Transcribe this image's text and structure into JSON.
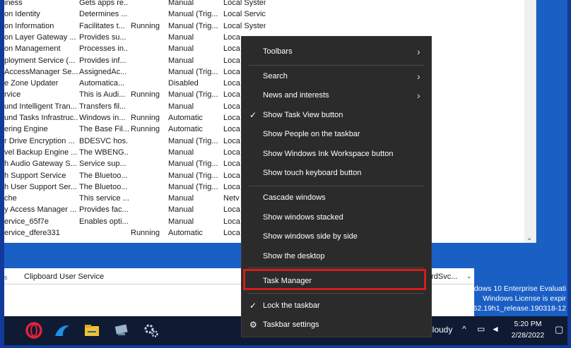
{
  "services": {
    "rows": [
      [
        "iness",
        "Gets apps re...",
        "",
        "Manual",
        "Local System"
      ],
      [
        "on Identity",
        "Determines ...",
        "",
        "Manual (Trig...",
        "Local Service"
      ],
      [
        "on Information",
        "Facilitates t...",
        "Running",
        "Manual (Trig...",
        "Local System"
      ],
      [
        "on Layer Gateway ...",
        "Provides su...",
        "",
        "Manual",
        "Loca"
      ],
      [
        "on Management",
        "Processes in...",
        "",
        "Manual",
        "Loca"
      ],
      [
        "ployment Service (...",
        "Provides inf...",
        "",
        "Manual",
        "Loca"
      ],
      [
        "AccessManager Se...",
        "AssignedAc...",
        "",
        "Manual (Trig...",
        "Loca"
      ],
      [
        "e Zone Updater",
        "Automatica...",
        "",
        "Disabled",
        "Loca"
      ],
      [
        "rvice",
        "This is Audi...",
        "Running",
        "Manual (Trig...",
        "Loca"
      ],
      [
        "und Intelligent Tran...",
        "Transfers fil...",
        "",
        "Manual",
        "Loca"
      ],
      [
        "und Tasks Infrastruc...",
        "Windows in...",
        "Running",
        "Automatic",
        "Loca"
      ],
      [
        "ering Engine",
        "The Base Fil...",
        "Running",
        "Automatic",
        "Loca"
      ],
      [
        "r Drive Encryption ...",
        "BDESVC hos...",
        "",
        "Manual (Trig...",
        "Loca"
      ],
      [
        "vel Backup Engine ...",
        "The WBENG...",
        "",
        "Manual",
        "Loca"
      ],
      [
        "h Audio Gateway S...",
        "Service sup...",
        "",
        "Manual (Trig...",
        "Loca"
      ],
      [
        "h Support Service",
        "The Bluetoo...",
        "",
        "Manual (Trig...",
        "Loca"
      ],
      [
        "h User Support Ser...",
        "The Bluetoo...",
        "",
        "Manual (Trig...",
        "Loca"
      ],
      [
        "che",
        "This service ...",
        "",
        "Manual",
        "Netv"
      ],
      [
        "y Access Manager ...",
        "Provides fac...",
        "",
        "Manual",
        "Loca"
      ],
      [
        "ervice_65f7e",
        "Enables opti...",
        "",
        "Manual",
        "Loca"
      ],
      [
        "ervice_dfere331",
        "",
        "Running",
        "Automatic",
        "Loca"
      ]
    ]
  },
  "lower_panel": {
    "header_label": "Clipboard User Service",
    "header_right": "ardSvc...",
    "side_mark": "s"
  },
  "watermark": {
    "line1": "indows 10 Enterprise Evaluati",
    "line2": "Windows License is expir",
    "line3": "Build 18362.19h1_release.190318-12"
  },
  "tray": {
    "weather": "Cloudy",
    "time": "5:20 PM",
    "date": "2/28/2022"
  },
  "context_menu": {
    "toolbars": "Toolbars",
    "search": "Search",
    "news": "News and interests",
    "task_view": "Show Task View button",
    "people": "Show People on the taskbar",
    "ink": "Show Windows Ink Workspace button",
    "touch_kb": "Show touch keyboard button",
    "cascade": "Cascade windows",
    "stacked": "Show windows stacked",
    "side_by_side": "Show windows side by side",
    "desktop": "Show the desktop",
    "task_manager": "Task Manager",
    "lock": "Lock the taskbar",
    "settings": "Taskbar settings"
  },
  "colors": {
    "desktop": "#1a5fc4",
    "taskbar": "#0f1a33",
    "menu_bg": "#2b2b2b",
    "highlight": "#d81b1b"
  }
}
